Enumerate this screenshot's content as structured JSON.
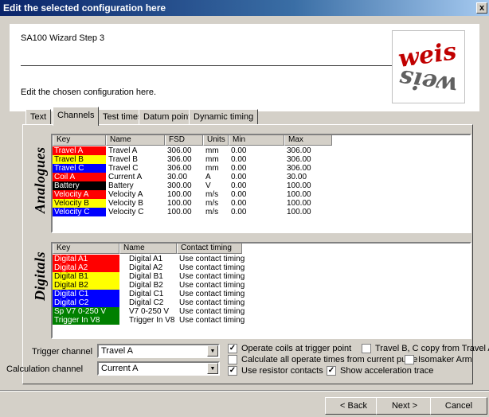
{
  "window": {
    "title": "Edit the selected configuration here",
    "close_label": "x"
  },
  "header": {
    "wizard_step": "SA100 Wizard Step 3",
    "subtitle": "Edit the chosen configuration here.",
    "logo_text": "weis"
  },
  "tabs": [
    {
      "label": "Text"
    },
    {
      "label": "Channels"
    },
    {
      "label": "Test times"
    },
    {
      "label": "Datum points"
    },
    {
      "label": "Dynamic timing"
    }
  ],
  "analogues": {
    "section_label": "Analogues",
    "columns": [
      "Key",
      "Name",
      "FSD",
      "Units",
      "Min",
      "Max"
    ],
    "rows": [
      {
        "key": "Travel A",
        "color": "#ff0000",
        "text": "#fff",
        "name": "Travel A",
        "fsd": "306.00",
        "units": "mm",
        "min": "0.00",
        "max": "306.00"
      },
      {
        "key": "Travel B",
        "color": "#ffff00",
        "text": "#000",
        "name": "Travel B",
        "fsd": "306.00",
        "units": "mm",
        "min": "0.00",
        "max": "306.00"
      },
      {
        "key": "Travel C",
        "color": "#0000ff",
        "text": "#fff",
        "name": "Travel C",
        "fsd": "306.00",
        "units": "mm",
        "min": "0.00",
        "max": "306.00"
      },
      {
        "key": "Coil A",
        "color": "#ff0000",
        "text": "#fff",
        "name": "Current A",
        "fsd": "30.00",
        "units": "A",
        "min": "0.00",
        "max": "30.00"
      },
      {
        "key": "Battery",
        "color": "#000000",
        "text": "#fff",
        "name": "Battery",
        "fsd": "300.00",
        "units": "V",
        "min": "0.00",
        "max": "100.00"
      },
      {
        "key": "Velocity A",
        "color": "#ff0000",
        "text": "#fff",
        "name": "Velocity A",
        "fsd": "100.00",
        "units": "m/s",
        "min": "0.00",
        "max": "100.00"
      },
      {
        "key": "Velocity B",
        "color": "#ffff00",
        "text": "#000",
        "name": "Velocity B",
        "fsd": "100.00",
        "units": "m/s",
        "min": "0.00",
        "max": "100.00"
      },
      {
        "key": "Velocity C",
        "color": "#0000ff",
        "text": "#fff",
        "name": "Velocity C",
        "fsd": "100.00",
        "units": "m/s",
        "min": "0.00",
        "max": "100.00"
      }
    ]
  },
  "digitals": {
    "section_label": "Digitals",
    "columns": [
      "Key",
      "Name",
      "Contact timing"
    ],
    "rows": [
      {
        "key": "Digital A1",
        "color": "#ff0000",
        "text": "#fff",
        "name": "Digital A1",
        "timing": "Use contact timing"
      },
      {
        "key": "Digital A2",
        "color": "#ff0000",
        "text": "#fff",
        "name": "Digital A2",
        "timing": "Use contact timing"
      },
      {
        "key": "Digital B1",
        "color": "#ffff00",
        "text": "#000",
        "name": "Digital B1",
        "timing": "Use contact timing"
      },
      {
        "key": "Digital B2",
        "color": "#ffff00",
        "text": "#000",
        "name": "Digital B2",
        "timing": "Use contact timing"
      },
      {
        "key": "Digital C1",
        "color": "#0000ff",
        "text": "#fff",
        "name": "Digital C1",
        "timing": "Use contact timing"
      },
      {
        "key": "Digital C2",
        "color": "#0000ff",
        "text": "#fff",
        "name": "Digital C2",
        "timing": "Use contact timing"
      },
      {
        "key": "Sp V7 0-250 V",
        "color": "#008000",
        "text": "#fff",
        "name": "V7 0-250 V",
        "timing": "Use contact timing"
      },
      {
        "key": "Trigger In V8",
        "color": "#008000",
        "text": "#fff",
        "name": "Trigger In V8",
        "timing": "Use contact timing"
      }
    ]
  },
  "trigger": {
    "label": "Trigger channel",
    "value": "Travel A"
  },
  "calculation": {
    "label": "Calculation channel",
    "value": "Current A"
  },
  "options": {
    "operate_coils": {
      "label": "Operate coils at trigger point",
      "checked": true
    },
    "travel_copy": {
      "label": "Travel B, C copy from Travel A",
      "checked": false
    },
    "calc_operate": {
      "label": "Calculate all operate times from current pulse",
      "checked": false
    },
    "isomaker": {
      "label": "Isomaker Arm",
      "checked": false
    },
    "resistor": {
      "label": "Use resistor contacts",
      "checked": true
    },
    "accel": {
      "label": "Show acceleration trace",
      "checked": true
    }
  },
  "buttons": {
    "back": "< Back",
    "next": "Next >",
    "cancel": "Cancel"
  }
}
